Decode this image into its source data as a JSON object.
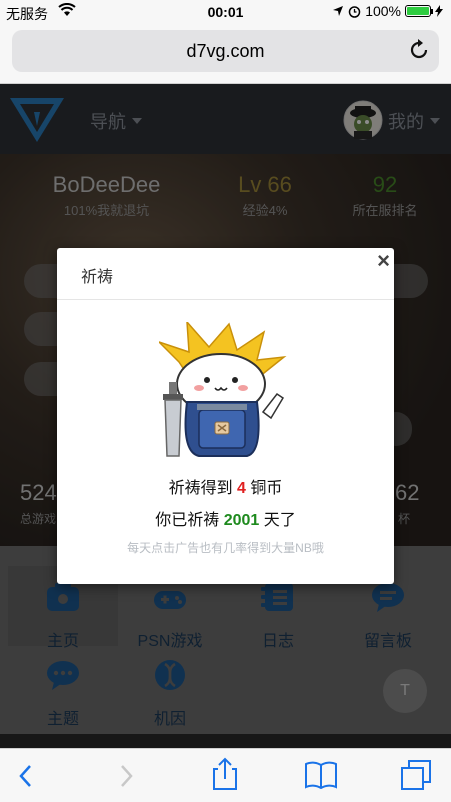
{
  "status_bar": {
    "carrier": "无服务",
    "time": "00:01",
    "battery": "100%"
  },
  "browser": {
    "url": "d7vg.com"
  },
  "navbar": {
    "nav_label": "导航",
    "me_label": "我的"
  },
  "profile": {
    "username": "BoDeeDee",
    "username_sub": "101%我就退坑",
    "level": "Lv 66",
    "level_sub": "经验4%",
    "rank": "92",
    "rank_sub": "所在服排名",
    "total_games_value": "524",
    "total_games_label": "总游戏",
    "cups_value": "62",
    "cups_label": "杯"
  },
  "menu": {
    "items": [
      {
        "label": "主页"
      },
      {
        "label": "PSN游戏"
      },
      {
        "label": "日志"
      },
      {
        "label": "留言板"
      },
      {
        "label": "主题"
      },
      {
        "label": "机因"
      }
    ],
    "float_button": "T"
  },
  "modal": {
    "title": "祈祷",
    "close_symbol": "×",
    "coins_prefix": "祈祷得到",
    "coins_value": "4",
    "coins_suffix": "铜币",
    "days_prefix": "你已祈祷",
    "days_value": "2001",
    "days_suffix": "天了",
    "hint": "每天点击广告也有几率得到大量NB哦"
  },
  "colors": {
    "accent_green": "#1e8a1e",
    "accent_red": "#e02020",
    "brand_blue": "#1e5a92"
  }
}
